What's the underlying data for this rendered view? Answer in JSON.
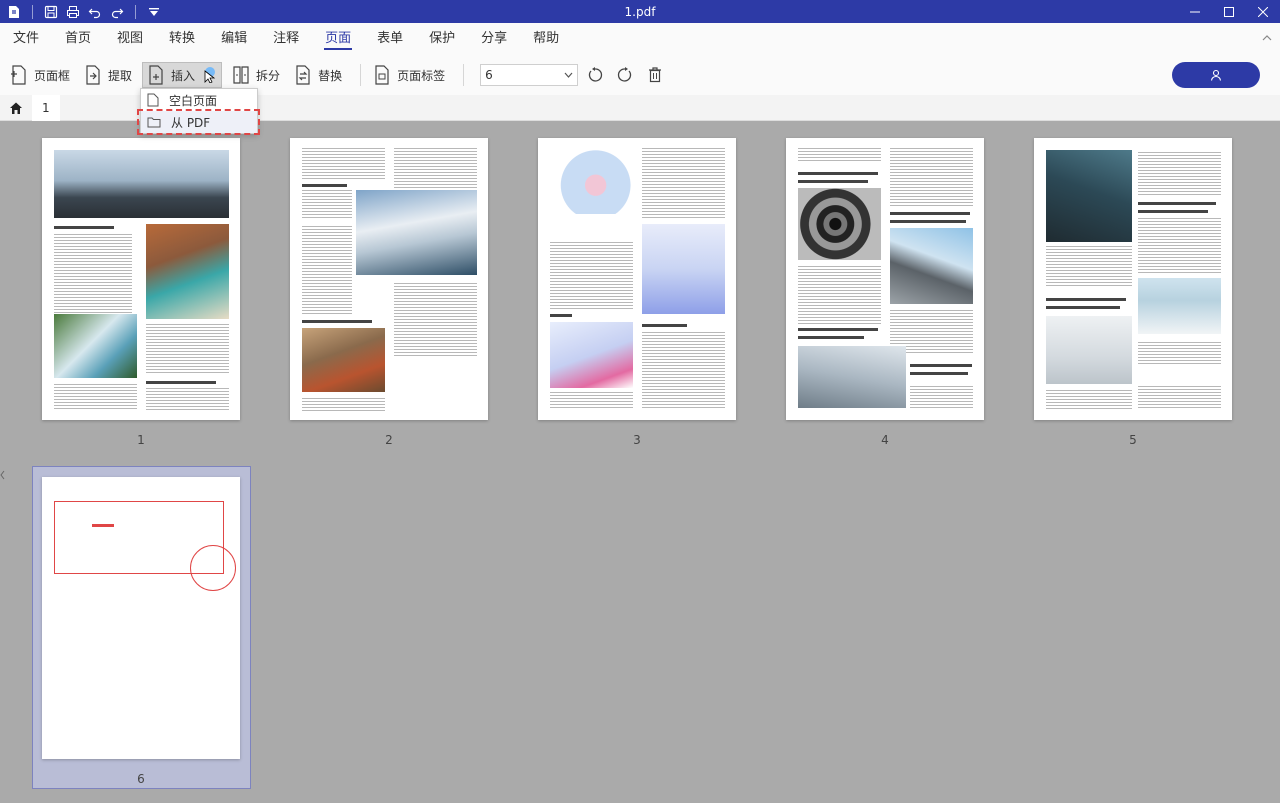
{
  "titlebar": {
    "title": "1.pdf",
    "icons": [
      "app-logo-icon",
      "save-icon",
      "print-icon",
      "undo-icon",
      "redo-icon",
      "customize-icon"
    ]
  },
  "menu": {
    "items": [
      "文件",
      "首页",
      "视图",
      "转换",
      "编辑",
      "注释",
      "页面",
      "表单",
      "保护",
      "分享",
      "帮助"
    ],
    "active_index": 6
  },
  "toolbar": {
    "page_box": "页面框",
    "extract": "提取",
    "insert": "插入",
    "split": "拆分",
    "replace": "替换",
    "page_label": "页面标签",
    "page_select_value": "6"
  },
  "tab": {
    "doc_label": "1"
  },
  "dropdown": {
    "blank_page": "空白页面",
    "from_pdf": "从 PDF"
  },
  "pages": {
    "labels": [
      "1",
      "2",
      "3",
      "4",
      "5",
      "6"
    ],
    "selected_index": 5
  },
  "colors": {
    "brand": "#2d3aa6",
    "annotation_red": "#e04646",
    "workspace": "#aaaaaa"
  }
}
